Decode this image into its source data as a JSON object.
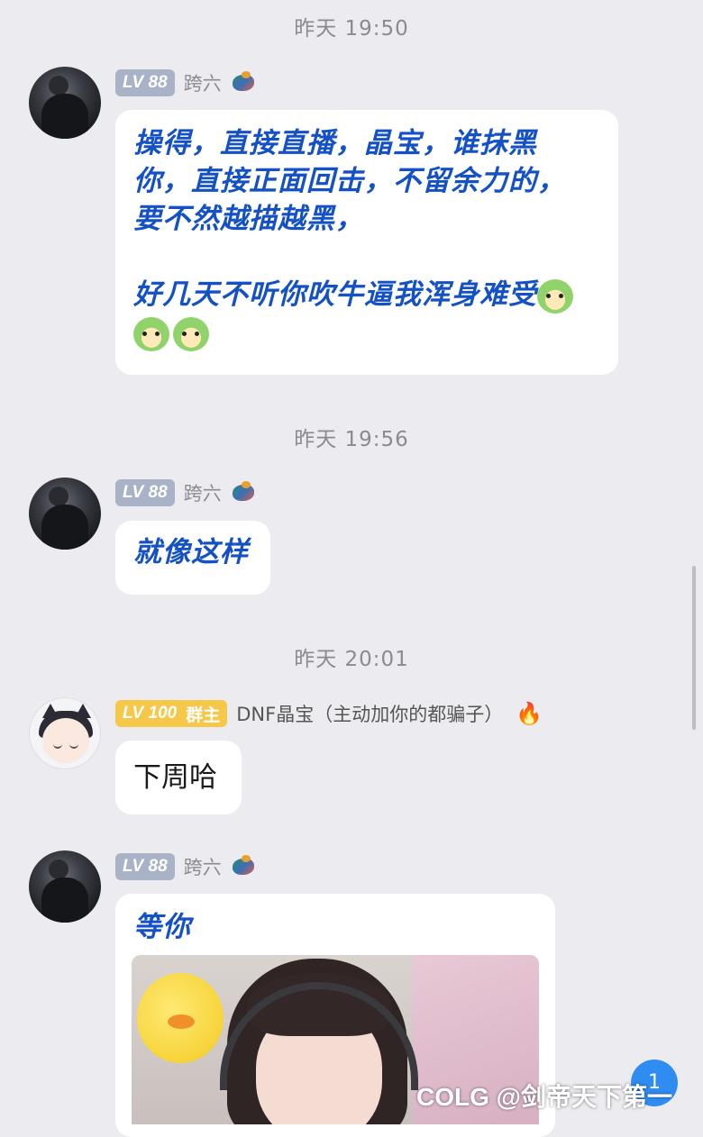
{
  "timestamps": [
    "昨天 19:50",
    "昨天 19:56",
    "昨天 20:01"
  ],
  "messages": [
    {
      "level": "LV 88",
      "name": "跨六",
      "lines": [
        "操得，直接直播，晶宝，谁抹黑",
        "你，直接正面回击，不留余力的，",
        "要不然越描越黑，",
        "",
        "好几天不听你吹牛逼我浑身难受"
      ]
    },
    {
      "level": "LV 88",
      "name": "跨六",
      "text": "就像这样"
    },
    {
      "level": "LV 100",
      "role": "群主",
      "name": "DNF晶宝（主动加你的都骗子）",
      "text": "下周哈"
    },
    {
      "level": "LV 88",
      "name": "跨六",
      "text": "等你"
    }
  ],
  "fab_badge": "1",
  "watermark": "COLG @剑帝天下第一"
}
